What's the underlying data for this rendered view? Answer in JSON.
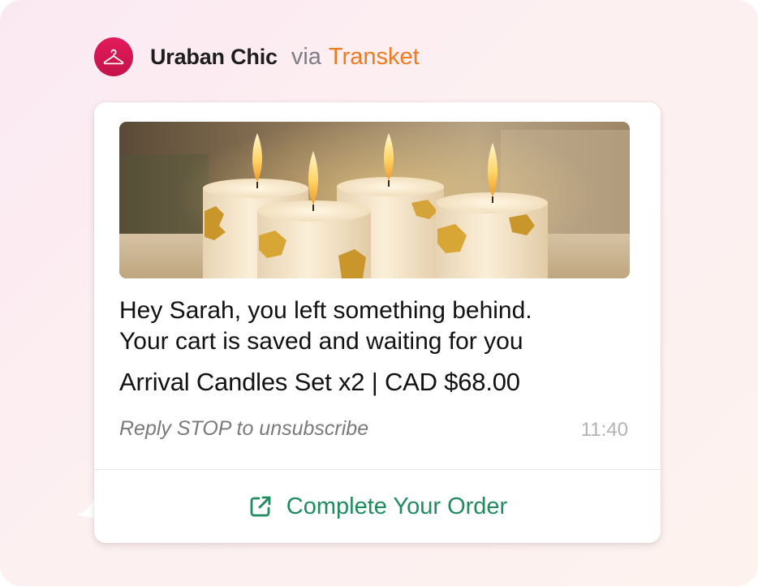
{
  "sender": {
    "name": "Uraban Chic",
    "via": "via",
    "platform": "Transket",
    "avatar_icon": "hanger-icon"
  },
  "message": {
    "image_alt": "Four lit pillar candles with gold leaf",
    "line1": "Hey Sarah, you left something behind.",
    "line2": "Your cart is saved and waiting for you",
    "product": "Arrival Candles Set x2 | CAD $68.00",
    "optout": "Reply STOP to unsubscribe",
    "time": "11:40"
  },
  "action": {
    "label": "Complete Your Order",
    "icon": "external-link-icon"
  },
  "colors": {
    "brand_avatar": "#d81753",
    "platform": "#f07a1f",
    "cta": "#1e8c5e"
  }
}
